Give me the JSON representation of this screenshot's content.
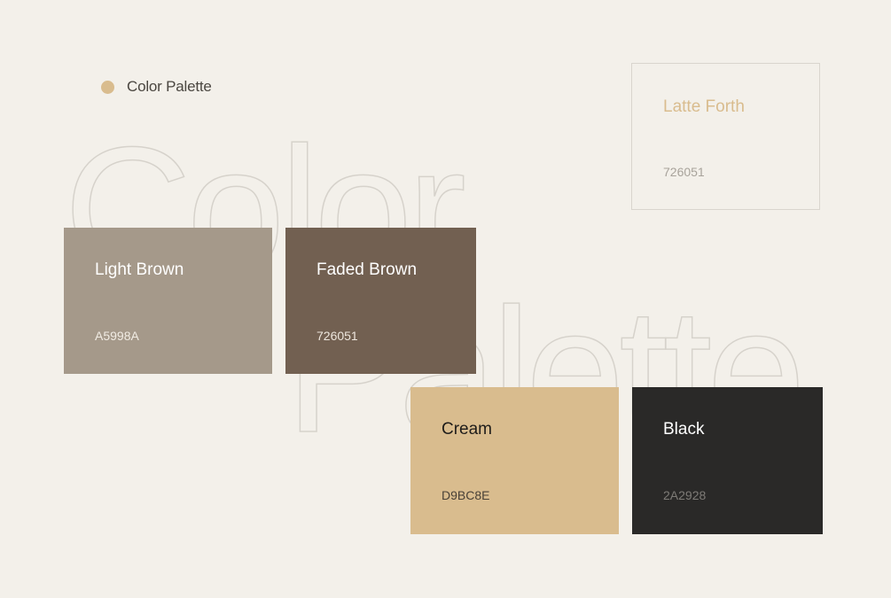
{
  "header": {
    "title": "Color Palette",
    "dot_color": "#D9BC8E"
  },
  "background_text": {
    "line1": "Color",
    "line2": "Palette",
    "outline_color": "#D6D2CB"
  },
  "outline_card": {
    "name": "Latte Forth",
    "code": "726051",
    "name_color": "#D9BC8E",
    "code_color": "#A8A39B",
    "border_color": "#D9D5CE"
  },
  "swatches": [
    {
      "name": "Light Brown",
      "code": "A5998A",
      "fill": "#A5998A",
      "name_color": "#FFFFFF",
      "code_color": "#F1ECE4"
    },
    {
      "name": "Faded Brown",
      "code": "726051",
      "fill": "#726051",
      "name_color": "#FFFFFF",
      "code_color": "#EDE6DD"
    },
    {
      "name": "Cream",
      "code": "D9BC8E",
      "fill": "#D9BC8E",
      "name_color": "#1E1C1A",
      "code_color": "#4A4238"
    },
    {
      "name": "Black",
      "code": "2A2928",
      "fill": "#2A2928",
      "name_color": "#FFFFFF",
      "code_color": "#7E7B77"
    }
  ],
  "page_background": "#F3F0EA"
}
